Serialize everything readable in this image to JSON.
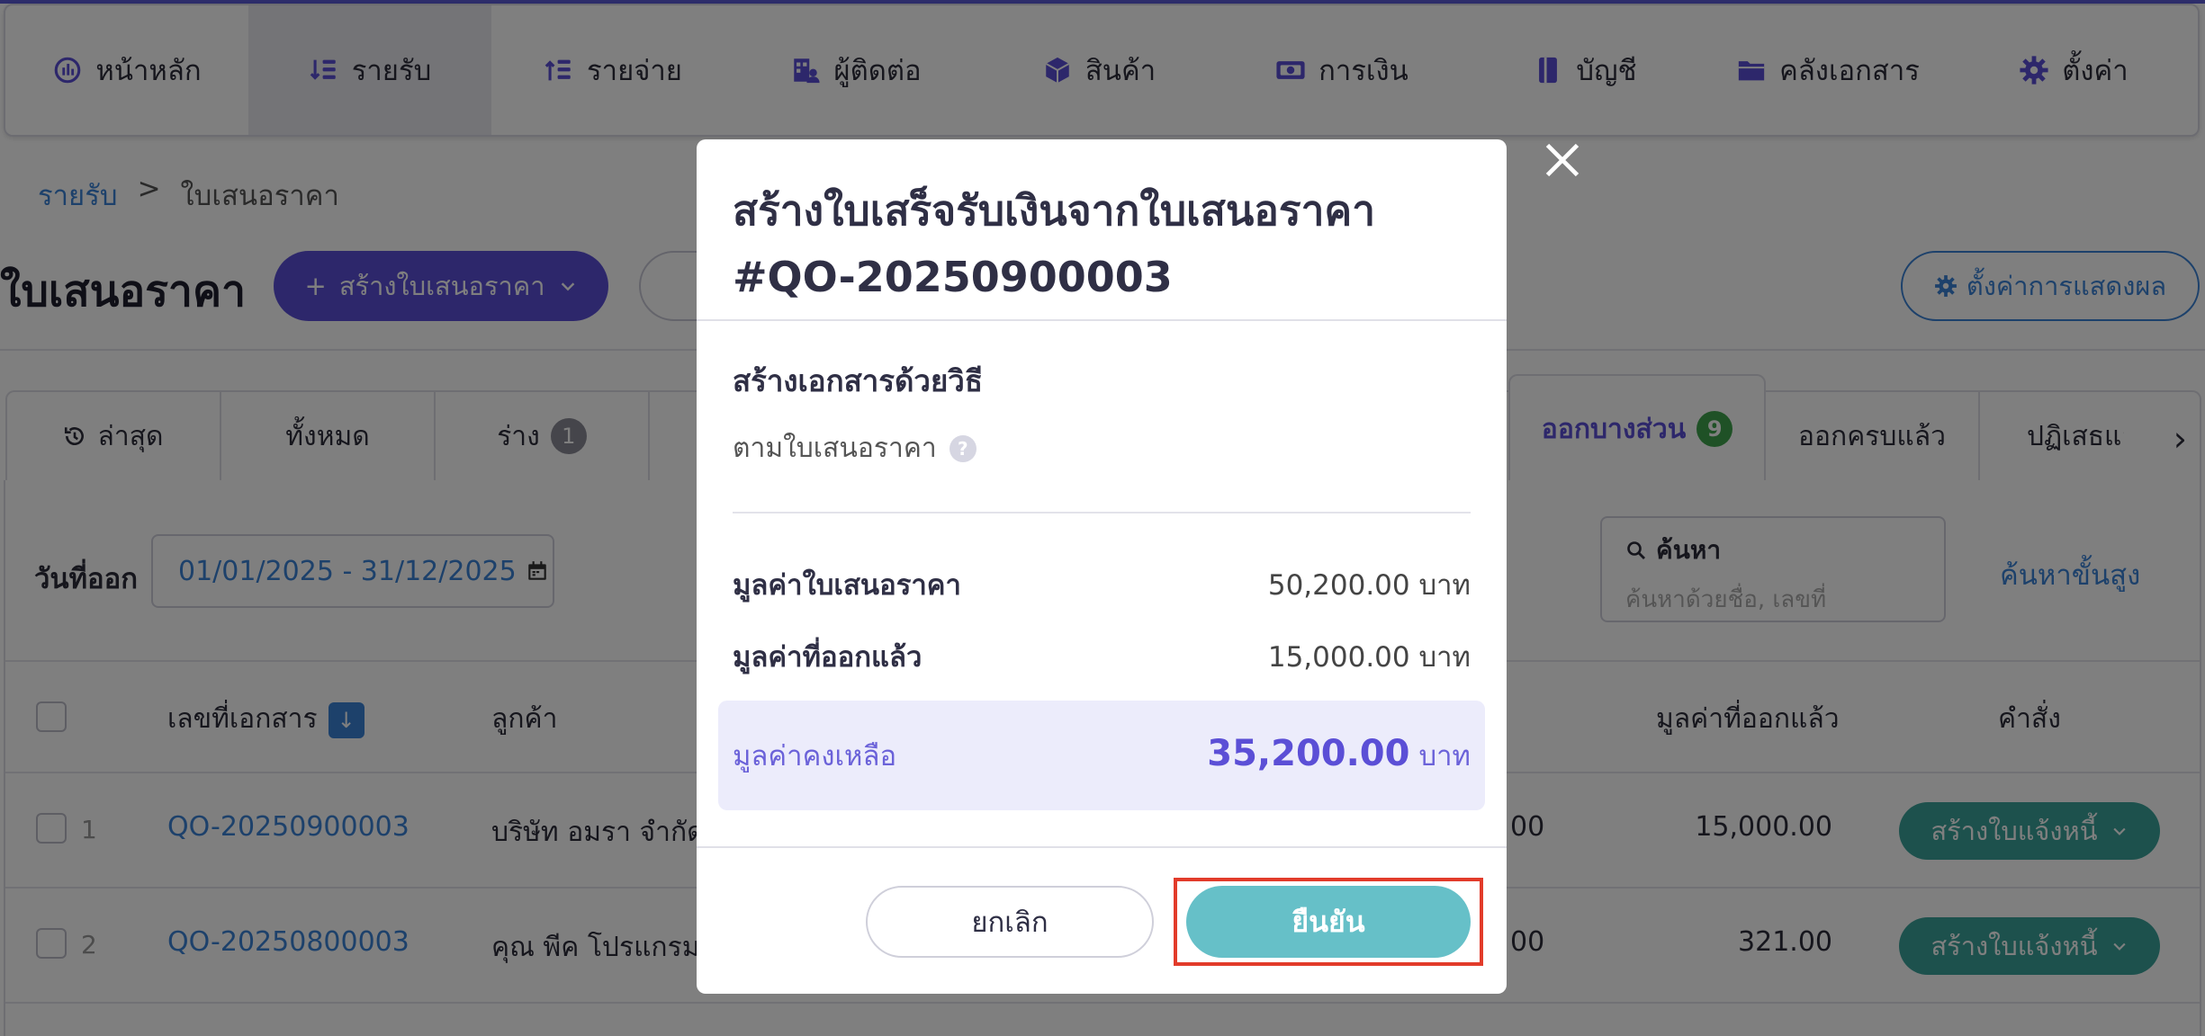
{
  "nav": {
    "items": [
      {
        "label": "หน้าหลัก",
        "icon": "dashboard-icon"
      },
      {
        "label": "รายรับ",
        "icon": "income-icon"
      },
      {
        "label": "รายจ่าย",
        "icon": "expense-icon"
      },
      {
        "label": "ผู้ติดต่อ",
        "icon": "contacts-icon"
      },
      {
        "label": "สินค้า",
        "icon": "box-icon"
      },
      {
        "label": "การเงิน",
        "icon": "money-icon"
      },
      {
        "label": "บัญชี",
        "icon": "book-icon"
      },
      {
        "label": "คลังเอกสาร",
        "icon": "folder-icon"
      },
      {
        "label": "ตั้งค่า",
        "icon": "gear-icon"
      }
    ],
    "active_index": 1
  },
  "breadcrumb": {
    "parent": "รายรับ",
    "sep": ">",
    "current": "ใบเสนอราคา"
  },
  "page": {
    "title": "ใบเสนอราคา",
    "create_label": "สร้างใบเสนอราคา",
    "display_settings_label": "ตั้งค่าการแสดงผล"
  },
  "tabs": {
    "latest": "ล่าสุด",
    "all": "ทั้งหมด",
    "draft": "ร่าง",
    "draft_count": "1",
    "partial": "ออกบางส่วน",
    "partial_count": "9",
    "complete": "ออกครบแล้ว",
    "rejected": "ปฏิเสธแล้"
  },
  "filters": {
    "date_label": "วันที่ออก",
    "date_range": "01/01/2025 - 31/12/2025",
    "search_label": "ค้นหา",
    "search_placeholder": "ค้นหาด้วยชื่อ, เลขที่",
    "advanced_search": "ค้นหาขั้นสูง"
  },
  "table": {
    "headers": {
      "doc_no": "เลขที่เอกสาร",
      "customer": "ลูกค้า",
      "issued": "มูลค่าที่ออกแล้ว",
      "command": "คำสั่ง"
    },
    "rows": [
      {
        "num": "1",
        "doc_no": "QO-20250900003",
        "customer": "บริษัท อมรา จำกัด",
        "partial_amount": "00",
        "issued": "15,000.00",
        "command": "สร้างใบแจ้งหนี้"
      },
      {
        "num": "2",
        "doc_no": "QO-20250800003",
        "customer": "คุณ พีค โปรแกรม",
        "partial_amount": "00",
        "issued": "321.00",
        "command": "สร้างใบแจ้งหนี้"
      }
    ]
  },
  "modal": {
    "title_line1": "สร้างใบเสร็จรับเงินจากใบเสนอราคา",
    "title_line2": "#QO-20250900003",
    "section_title": "สร้างเอกสารด้วยวิธี",
    "method": "ตามใบเสนอราคา",
    "help": "?",
    "quote_value_label": "มูลค่าใบเสนอราคา",
    "quote_value": "50,200.00 บาท",
    "issued_value_label": "มูลค่าที่ออกแล้ว",
    "issued_value": "15,000.00 บาท",
    "remaining_label": "มูลค่าคงเหลือ",
    "remaining_value": "35,200.00",
    "remaining_unit": "บาท",
    "cancel_label": "ยกเลิก",
    "confirm_label": "ยืนยัน"
  },
  "colors": {
    "primary": "#5b4fd6",
    "link": "#3b82d6",
    "teal": "#3aa39a",
    "confirm": "#66c0c8",
    "highlight": "#e23b2a"
  }
}
